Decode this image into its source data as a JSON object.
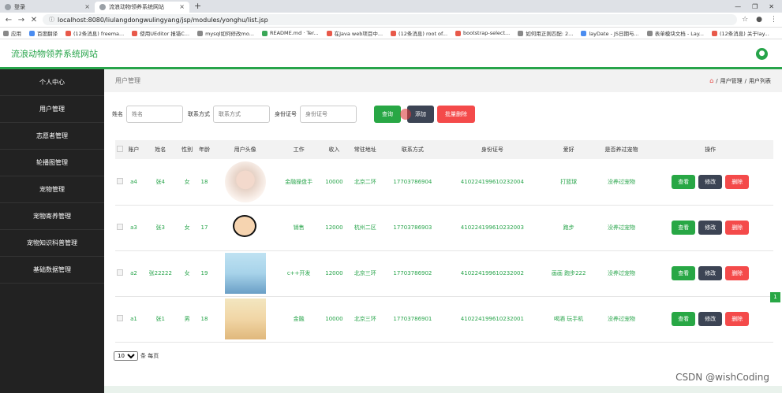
{
  "browser": {
    "tabs": [
      {
        "title": "登录"
      },
      {
        "title": "流浪动物领养系统网站"
      }
    ],
    "url": "localhost:8080/liulangdongwulingyang/jsp/modules/yonghu/list.jsp",
    "bookmarks": [
      "应用",
      "百度翻译",
      "(12条消息) freema...",
      "使用UEditor 报错C...",
      "mysql如何修改mo...",
      "README.md · Ter...",
      "在Java web项目中...",
      "(12条消息) root of...",
      "bootstrap-select...",
      "如何用正则匹配: 2...",
      "layDate - JS日期与...",
      "表单模块文档 - Lay...",
      "(12条消息) 关于lay..."
    ]
  },
  "app": {
    "title": "流浪动物领养系统网站",
    "user_icon": "user-icon"
  },
  "sidebar": {
    "items": [
      {
        "label": "个人中心"
      },
      {
        "label": "用户管理"
      },
      {
        "label": "志愿者管理"
      },
      {
        "label": "轮播图管理"
      },
      {
        "label": "宠物管理"
      },
      {
        "label": "宠物寄养管理"
      },
      {
        "label": "宠物知识科普管理"
      },
      {
        "label": "基础数据管理"
      }
    ]
  },
  "page": {
    "title": "用户管理",
    "breadcrumb": {
      "sep": "/",
      "level1": "用户管理",
      "level2": "用户列表"
    }
  },
  "search": {
    "name_label": "姓名",
    "name_placeholder": "姓名",
    "phone_label": "联系方式",
    "phone_placeholder": "联系方式",
    "idcard_label": "身份证号",
    "idcard_placeholder": "身份证号",
    "query_button": "查询",
    "add_button": "添加",
    "batch_delete_button": "批量删除"
  },
  "table": {
    "headers": [
      "账户",
      "姓名",
      "性别",
      "年龄",
      "用户头像",
      "工作",
      "收入",
      "常驻地址",
      "联系方式",
      "身份证号",
      "爱好",
      "是否养过宠物",
      "操作"
    ],
    "rows": [
      {
        "account": "a4",
        "name": "张4",
        "gender": "女",
        "age": "18",
        "job": "金融操盘手",
        "income": "10000",
        "address": "北京二环",
        "phone": "17703786904",
        "idcard": "410224199610232004",
        "hobby": "打篮球",
        "pet": "没养过宠物"
      },
      {
        "account": "a3",
        "name": "张3",
        "gender": "女",
        "age": "17",
        "job": "销售",
        "income": "12000",
        "address": "杭州二区",
        "phone": "17703786903",
        "idcard": "410224199610232003",
        "hobby": "跑步",
        "pet": "没养过宠物"
      },
      {
        "account": "a2",
        "name": "张22222",
        "gender": "女",
        "age": "19",
        "job": "c++开发",
        "income": "12000",
        "address": "北京三环",
        "phone": "17703786902",
        "idcard": "410224199610232002",
        "hobby": "画画 跑步222",
        "pet": "没养过宠物"
      },
      {
        "account": "a1",
        "name": "张1",
        "gender": "男",
        "age": "18",
        "job": "金融",
        "income": "10000",
        "address": "北京三环",
        "phone": "17703786901",
        "idcard": "410224199610232001",
        "hobby": "喝酒 玩手机",
        "pet": "没养过宠物"
      }
    ],
    "actions": {
      "view": "查看",
      "edit": "修改",
      "delete": "删除"
    }
  },
  "pager": {
    "page_size": "10",
    "per_page_label": "条 每页",
    "current_page": "1"
  },
  "watermark": "CSDN @wishCoding",
  "colors": {
    "accent": "#27a44a",
    "sidebar": "#222222",
    "danger": "#f44a4a",
    "dark_button": "#3c4454"
  }
}
